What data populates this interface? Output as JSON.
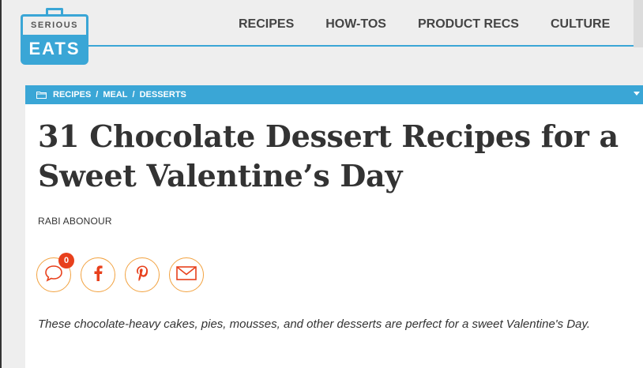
{
  "header": {
    "logo_top": "SERIOUS",
    "logo_bottom": "EATS",
    "nav": [
      "RECIPES",
      "HOW-TOS",
      "PRODUCT RECS",
      "CULTURE"
    ],
    "accent_color": "#3aa6d6"
  },
  "breadcrumb": {
    "icon": "folder-icon",
    "items": [
      "RECIPES",
      "MEAL",
      "DESSERTS"
    ],
    "separator": "/"
  },
  "article": {
    "title": "31 Chocolate Dessert Recipes for a Sweet Valentine’s Day",
    "author": "RABI ABONOUR",
    "comment_count": "0",
    "share_icons": [
      "comment-icon",
      "facebook-icon",
      "pinterest-icon",
      "email-icon"
    ],
    "share_color": "#e8401c",
    "dek": "These chocolate-heavy cakes, pies, mousses, and other desserts are perfect for a sweet Valentine's Day."
  }
}
